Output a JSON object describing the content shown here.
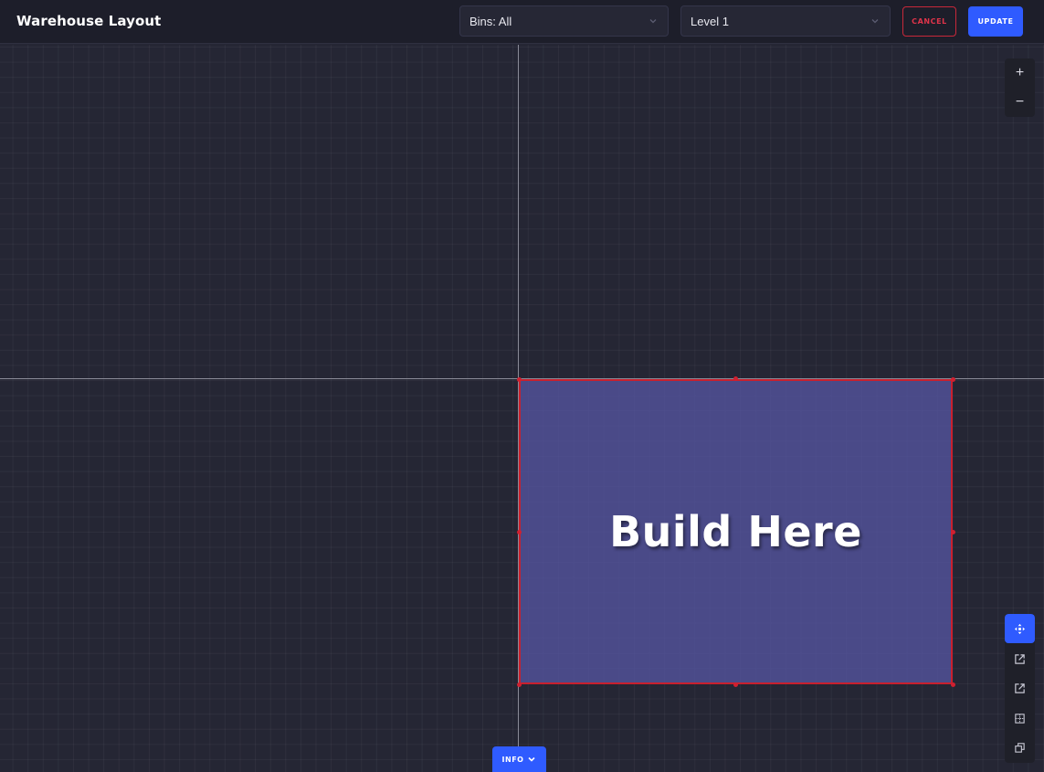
{
  "header": {
    "title": "Warehouse Layout",
    "bins_select": {
      "value": "Bins: All",
      "icon": "chevron-down-icon"
    },
    "level_select": {
      "value": "Level 1",
      "icon": "chevron-down-icon"
    },
    "cancel_label": "CANCEL",
    "update_label": "UPDATE"
  },
  "canvas": {
    "build_area_label": "Build Here",
    "zoom": {
      "in_label": "+",
      "out_label": "−"
    },
    "tools": [
      {
        "name": "move-icon",
        "active": true
      },
      {
        "name": "external-link-icon",
        "active": false
      },
      {
        "name": "external-link-icon",
        "active": false
      },
      {
        "name": "grid-icon",
        "active": false
      },
      {
        "name": "copy-icon",
        "active": false
      }
    ],
    "info_tab_label": "INFO"
  },
  "colors": {
    "accent": "#2f5bff",
    "danger": "#c8283a",
    "build_area_fill": "#5454a0",
    "background": "#252634"
  }
}
